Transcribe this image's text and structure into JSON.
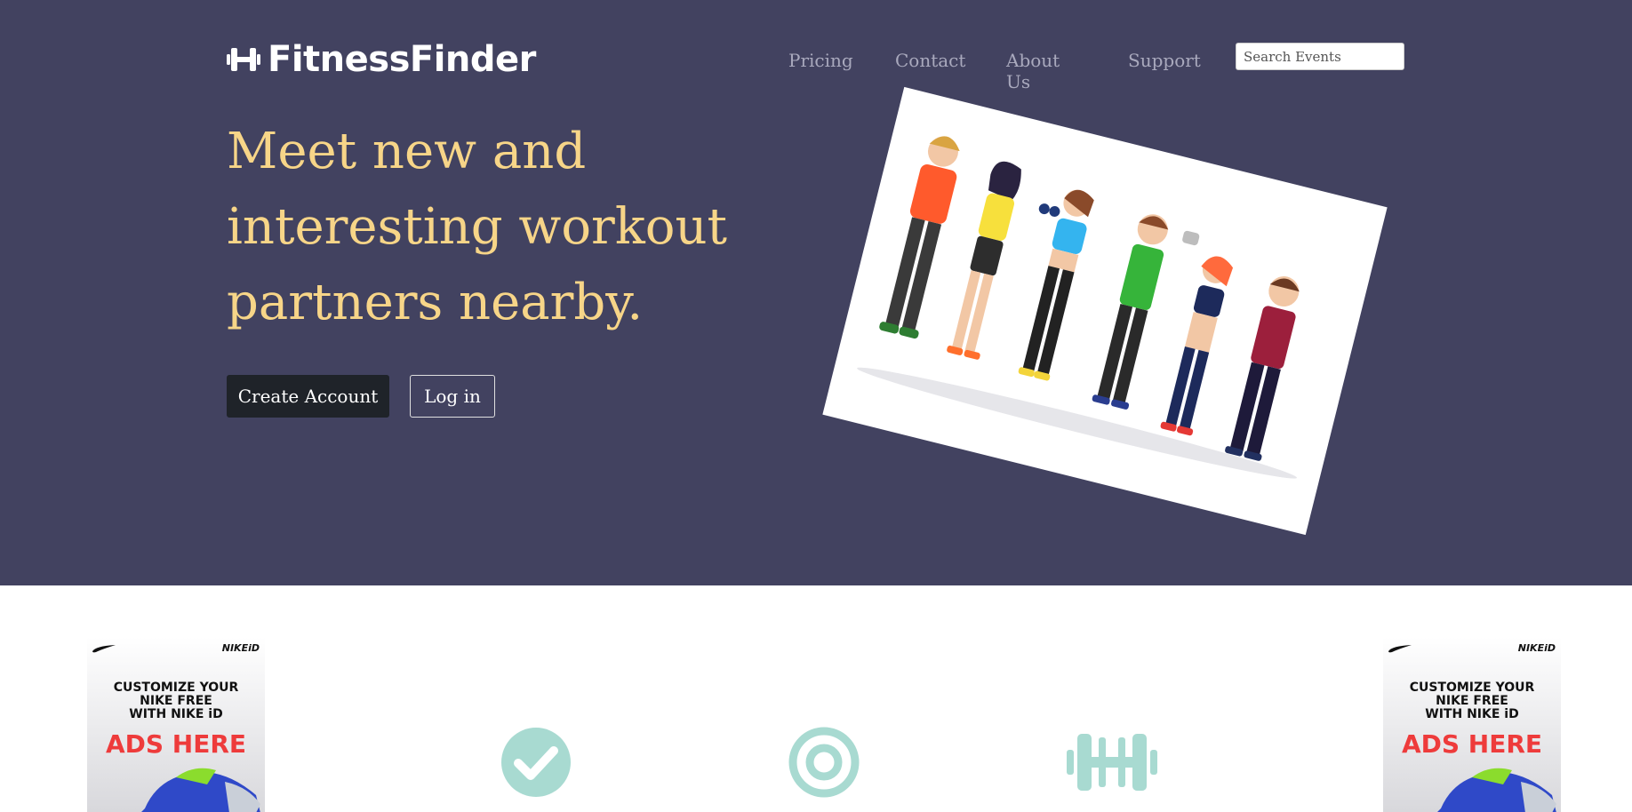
{
  "header": {
    "brand": "FitnessFinder",
    "brand_icon": "dumbbell-icon",
    "nav": [
      {
        "label": "Pricing"
      },
      {
        "label": "Contact"
      },
      {
        "label": "About Us"
      },
      {
        "label": "Support"
      }
    ],
    "search": {
      "placeholder": "Search Events",
      "value": ""
    }
  },
  "hero": {
    "headline_line1": "Meet new and",
    "headline_line2": "interesting workout",
    "headline_line3": "partners nearby.",
    "create_account_label": "Create Account",
    "login_label": "Log in",
    "image": "group-of-people-exercising-illustration"
  },
  "ads": {
    "left": {
      "brand": "NIKEiD",
      "line1": "CUSTOMIZE YOUR",
      "line2": "NIKE FREE",
      "line3": "WITH NIKE iD",
      "headline": "ADS HERE"
    },
    "right": {
      "brand": "NIKEiD",
      "line1": "CUSTOMIZE YOUR",
      "line2": "NIKE FREE",
      "line3": "WITH NIKE iD",
      "headline": "ADS HERE"
    }
  },
  "features": [
    {
      "icon": "check-circle-icon"
    },
    {
      "icon": "bullseye-icon"
    },
    {
      "icon": "dumbbell-icon"
    }
  ],
  "colors": {
    "hero_bg": "#424260",
    "headline": "#f7d588",
    "nav_text": "#a9a9bd",
    "feature_icon": "#a8dad1",
    "primary_button": "#1f2329",
    "ad_red": "#ee3b3b"
  }
}
